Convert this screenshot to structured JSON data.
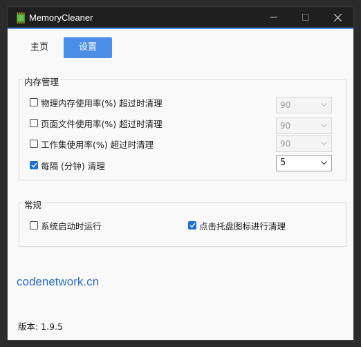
{
  "window": {
    "title": "MemoryCleaner",
    "accent_color": "#4a8ee8",
    "titlebar_color": "#1f1f1f"
  },
  "tabs": [
    {
      "label": "主页",
      "active": false
    },
    {
      "label": "设置",
      "active": true
    }
  ],
  "memory_group": {
    "title": "内存管理",
    "rows": [
      {
        "label": "物理内存使用率(%) 超过时清理",
        "checked": false,
        "value": "90",
        "enabled": false
      },
      {
        "label": "页面文件使用率(%) 超过时清理",
        "checked": false,
        "value": "90",
        "enabled": false
      },
      {
        "label": "工作集使用率(%) 超过时清理",
        "checked": false,
        "value": "90",
        "enabled": false
      },
      {
        "label": "每隔 (分钟) 清理",
        "checked": true,
        "value": "5",
        "enabled": true
      }
    ]
  },
  "general_group": {
    "title": "常规",
    "options": [
      {
        "label": "系统启动时运行",
        "checked": false
      },
      {
        "label": "点击托盘图标进行清理",
        "checked": true
      }
    ]
  },
  "watermark": "codenetwork.cn",
  "version": "版本: 1.9.5"
}
